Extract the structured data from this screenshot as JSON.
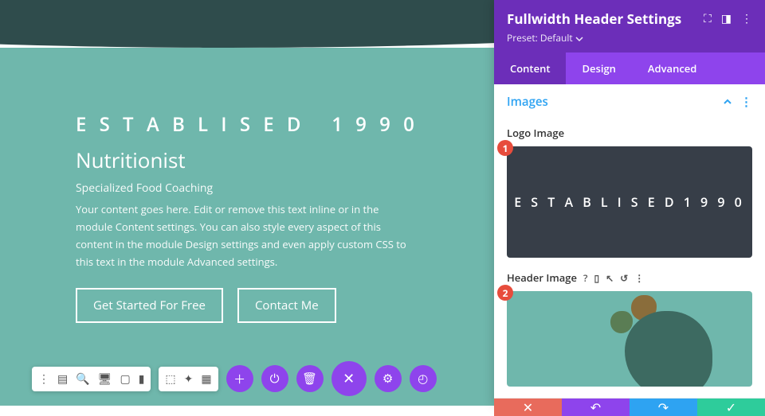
{
  "hero": {
    "logo_text": "E S T A B L I S E D   1 9 9 0",
    "title": "Nutritionist",
    "subtitle": "Specialized Food Coaching",
    "body": "Your content goes here. Edit or remove this text inline or in the module Content settings. You can also style every aspect of this content in the module Design settings and even apply custom CSS to this text in the module Advanced settings.",
    "btn_primary": "Get Started For Free",
    "btn_secondary": "Contact Me"
  },
  "panel": {
    "title": "Fullwidth Header Settings",
    "preset_label": "Preset: Default",
    "tabs": {
      "content": "Content",
      "design": "Design",
      "advanced": "Advanced"
    },
    "section_images": "Images",
    "field_logo": "Logo Image",
    "field_header": "Header Image",
    "logo_preview_text": "E S T A B L I S E D  1 9 9 0",
    "badge1": "1",
    "badge2": "2"
  },
  "colors": {
    "purple_dark": "#6c2eb9",
    "purple": "#8e44ec",
    "teal": "#6fb7ac",
    "red": "#e86b5c",
    "blue": "#2ea3f2",
    "green": "#2ecc9b"
  }
}
